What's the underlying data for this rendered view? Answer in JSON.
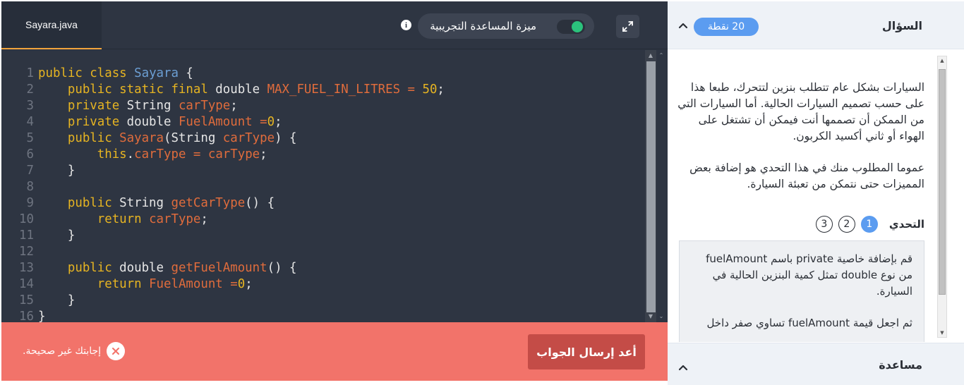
{
  "editor": {
    "file_tab": "Sayara.java",
    "assist_label": "ميزة المساعدة التجريبية",
    "assist_enabled": true,
    "info_glyph": "i",
    "code_lines": [
      {
        "n": "1",
        "tokens": [
          {
            "t": "public class ",
            "c": "kw"
          },
          {
            "t": "Sayara",
            "c": "cls"
          },
          {
            "t": " {",
            "c": "txt"
          }
        ]
      },
      {
        "n": "2",
        "tokens": [
          {
            "t": "    public static final ",
            "c": "kw"
          },
          {
            "t": "double ",
            "c": "txt"
          },
          {
            "t": "MAX_FUEL_IN_LITRES",
            "c": "id"
          },
          {
            "t": " = ",
            "c": "id"
          },
          {
            "t": "50",
            "c": "num"
          },
          {
            "t": ";",
            "c": "txt"
          }
        ]
      },
      {
        "n": "3",
        "tokens": [
          {
            "t": "    private ",
            "c": "kw"
          },
          {
            "t": "String ",
            "c": "txt"
          },
          {
            "t": "carType",
            "c": "id"
          },
          {
            "t": ";",
            "c": "txt"
          }
        ]
      },
      {
        "n": "4",
        "tokens": [
          {
            "t": "    private ",
            "c": "kw"
          },
          {
            "t": "double ",
            "c": "txt"
          },
          {
            "t": "FuelAmount =",
            "c": "id"
          },
          {
            "t": "0",
            "c": "num"
          },
          {
            "t": ";",
            "c": "txt"
          }
        ]
      },
      {
        "n": "5",
        "tokens": [
          {
            "t": "    public ",
            "c": "kw"
          },
          {
            "t": "Sayara",
            "c": "id"
          },
          {
            "t": "(String ",
            "c": "txt"
          },
          {
            "t": "carType",
            "c": "id"
          },
          {
            "t": ") {",
            "c": "txt"
          }
        ]
      },
      {
        "n": "6",
        "tokens": [
          {
            "t": "        this",
            "c": "kw"
          },
          {
            "t": ".",
            "c": "txt"
          },
          {
            "t": "carType",
            "c": "id"
          },
          {
            "t": " = ",
            "c": "id"
          },
          {
            "t": "carType",
            "c": "id"
          },
          {
            "t": ";",
            "c": "txt"
          }
        ]
      },
      {
        "n": "7",
        "tokens": [
          {
            "t": "    }",
            "c": "txt"
          }
        ]
      },
      {
        "n": "8",
        "tokens": []
      },
      {
        "n": "9",
        "tokens": [
          {
            "t": "    public ",
            "c": "kw"
          },
          {
            "t": "String ",
            "c": "txt"
          },
          {
            "t": "getCarType",
            "c": "id"
          },
          {
            "t": "() {",
            "c": "txt"
          }
        ]
      },
      {
        "n": "10",
        "tokens": [
          {
            "t": "        return ",
            "c": "kw"
          },
          {
            "t": "carType",
            "c": "id"
          },
          {
            "t": ";",
            "c": "txt"
          }
        ]
      },
      {
        "n": "11",
        "tokens": [
          {
            "t": "    }",
            "c": "txt"
          }
        ]
      },
      {
        "n": "12",
        "tokens": []
      },
      {
        "n": "13",
        "tokens": [
          {
            "t": "    public ",
            "c": "kw"
          },
          {
            "t": "double ",
            "c": "txt"
          },
          {
            "t": "getFuelAmount",
            "c": "id"
          },
          {
            "t": "() {",
            "c": "txt"
          }
        ]
      },
      {
        "n": "14",
        "tokens": [
          {
            "t": "        return ",
            "c": "kw"
          },
          {
            "t": "FuelAmount =",
            "c": "id"
          },
          {
            "t": "0",
            "c": "num"
          },
          {
            "t": ";",
            "c": "txt"
          }
        ]
      },
      {
        "n": "15",
        "tokens": [
          {
            "t": "    }",
            "c": "txt"
          }
        ]
      },
      {
        "n": "16",
        "tokens": [
          {
            "t": "}",
            "c": "txt"
          }
        ]
      }
    ]
  },
  "feedback": {
    "resubmit_label": "أعد إرسال الجواب",
    "error_text": "إجابتك غير صحيحة."
  },
  "question": {
    "title": "السؤال",
    "points": "20 نقطة",
    "paragraph1": "السيارات بشكل عام تتطلب بنزين لتتحرك، طبعا هذا على حسب تصميم السيارات الحالية. أما السيارات التي من الممكن أن تصممها أنت فيمكن أن تشتغل على الهواء أو ثاني أكسيد الكربون.",
    "paragraph2": "عموما المطلوب منك في هذا التحدي هو إضافة بعض المميزات حتى نتمكن من تعبئة السيارة.",
    "challenge_label": "التحدي",
    "steps": [
      "1",
      "2",
      "3"
    ],
    "active_step": "1",
    "task_p1": "قم بإضافة خاصية private باسم fuelAmount من نوع double تمثل كمية البنزين الحالية في السيارة.",
    "task_p2": "ثم اجعل قيمة fuelAmount تساوي صفر داخل"
  },
  "help": {
    "title": "مساعدة"
  },
  "colors": {
    "editor_bg": "#2e3542",
    "keyword": "#e6b422",
    "identifier": "#e06c3c",
    "class_name": "#6c9fd4",
    "error_bar": "#f2736a",
    "resubmit_button": "#c44c47",
    "accent_blue": "#5b9cf0",
    "toggle_on": "#2bc27c"
  },
  "icons": {
    "info": "info-icon",
    "expand": "expand-icon",
    "close_circle": "close-circle-icon",
    "chevron_up": "chevron-up-icon"
  }
}
